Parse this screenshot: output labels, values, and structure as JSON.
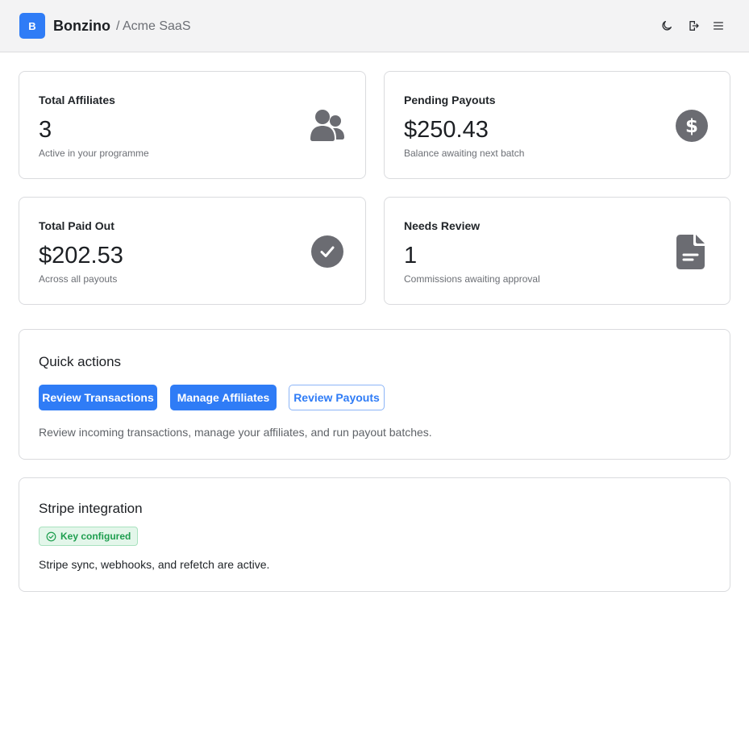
{
  "header": {
    "logo_letter": "B",
    "brand": "Bonzino",
    "crumb": "/ Acme SaaS",
    "icons": [
      "moon-icon",
      "logout-icon",
      "menu-icon"
    ]
  },
  "stats": [
    {
      "label": "Total Affiliates",
      "value": "3",
      "sub": "Active in your programme",
      "icon": "users-icon"
    },
    {
      "label": "Pending Payouts",
      "value": "$250.43",
      "sub": "Balance awaiting next batch",
      "icon": "dollar-circle-icon"
    },
    {
      "label": "Total Paid Out",
      "value": "$202.53",
      "sub": "Across all payouts",
      "icon": "check-circle-icon"
    },
    {
      "label": "Needs Review",
      "value": "1",
      "sub": "Commissions awaiting approval",
      "icon": "document-icon"
    }
  ],
  "quick_actions": {
    "title": "Quick actions",
    "buttons": [
      "Review Transactions",
      "Manage Affiliates",
      "Review Payouts"
    ],
    "description": "Review incoming transactions, manage your affiliates, and run payout batches."
  },
  "stripe": {
    "title": "Stripe integration",
    "badge": "Key configured",
    "description": "Stripe sync, webhooks, and refetch are active."
  },
  "colors": {
    "accent": "#2f7cf6",
    "icon_gray": "#6b6c72",
    "success": "#1e9e4f"
  }
}
